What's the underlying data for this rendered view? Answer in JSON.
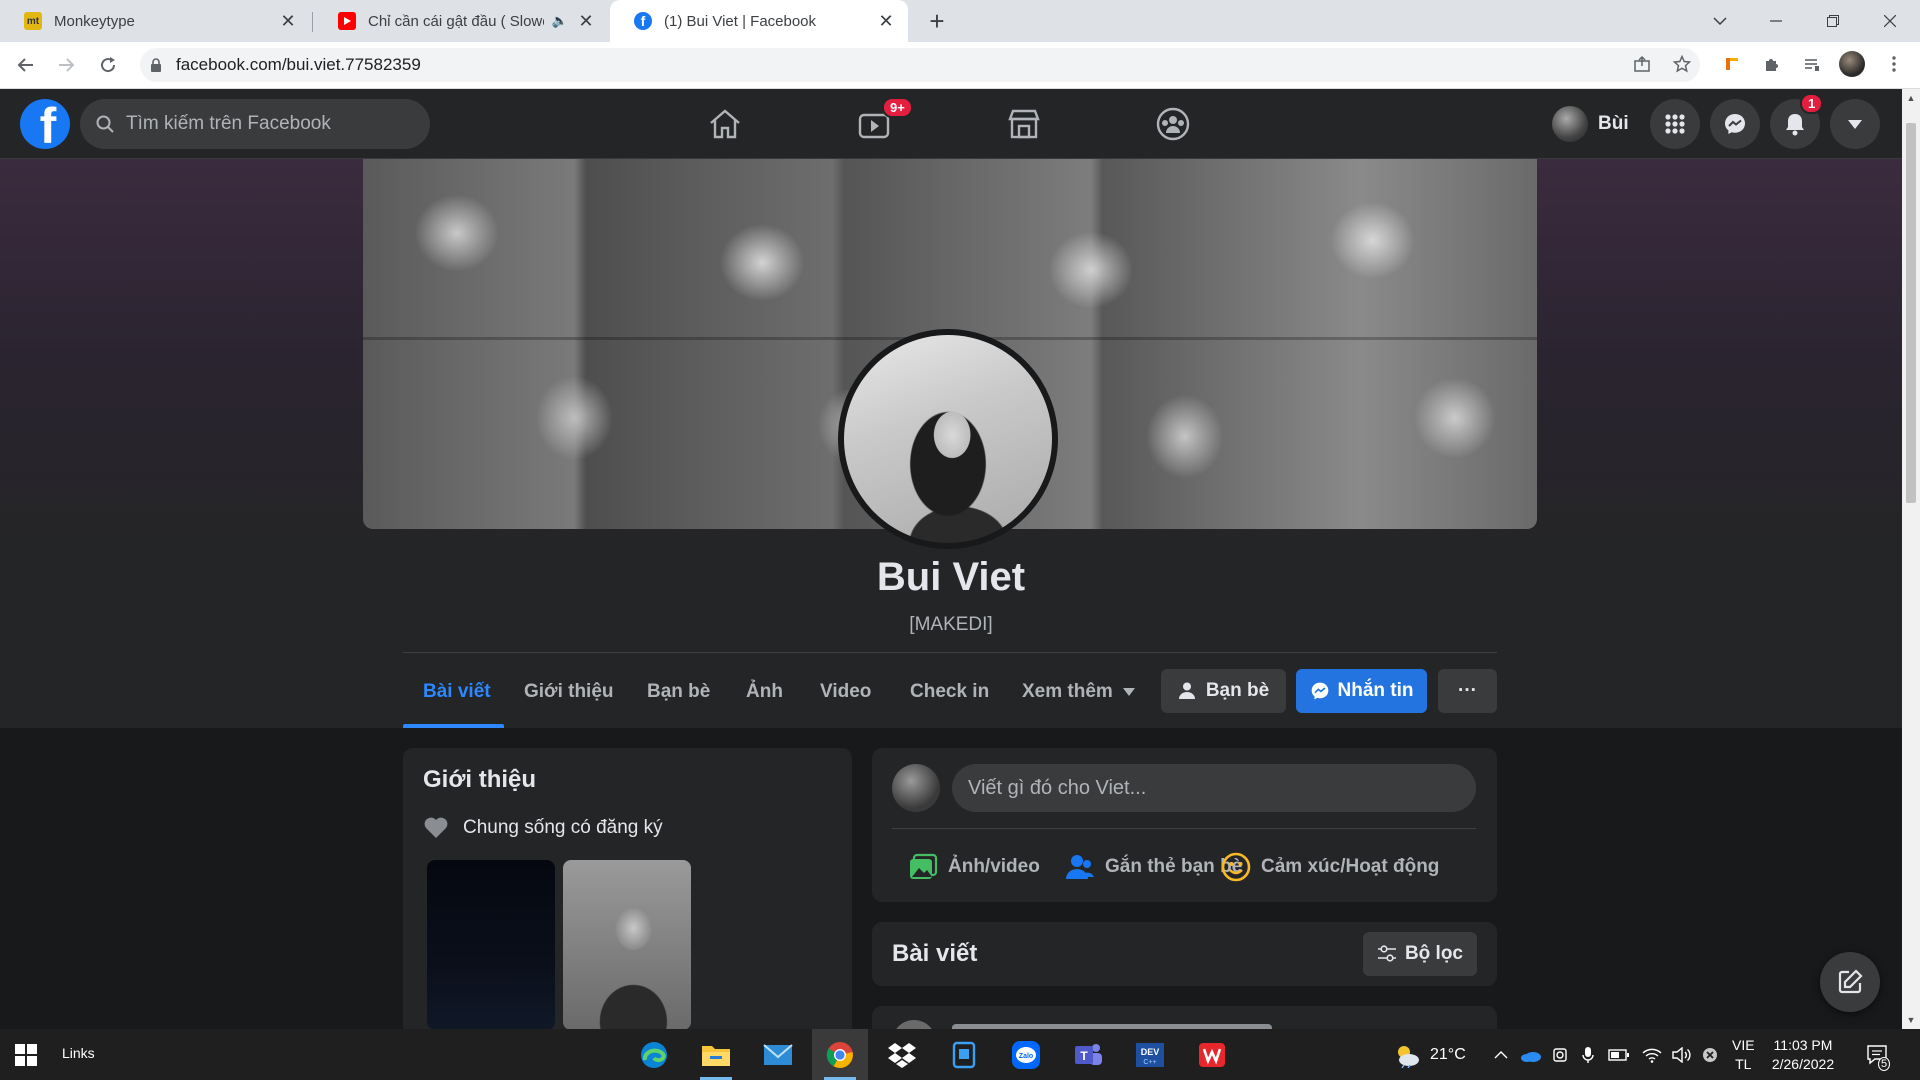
{
  "browser": {
    "tabs": [
      {
        "title": "Monkeytype",
        "favicon": "monkeytype-icon"
      },
      {
        "title": "Chỉ cần cái gật đầu ( Slowed",
        "favicon": "youtube-icon",
        "audio": true
      },
      {
        "title": "(1) Bui Viet | Facebook",
        "favicon": "facebook-icon",
        "active": true
      }
    ],
    "url": "facebook.com/bui.viet.77582359"
  },
  "fb": {
    "search_placeholder": "Tìm kiếm trên Facebook",
    "watch_badge": "9+",
    "notif_badge": "1",
    "user_short": "Bùi"
  },
  "profile": {
    "name": "Bui Viet",
    "subtitle": "[MAKEDI]",
    "tabs": [
      "Bài viết",
      "Giới thiệu",
      "Bạn bè",
      "Ảnh",
      "Video",
      "Check in",
      "Xem thêm"
    ],
    "btn_friends": "Bạn bè",
    "btn_message": "Nhắn tin",
    "btn_more": "···"
  },
  "intro": {
    "title": "Giới thiệu",
    "relationship": "Chung sống có đăng ký"
  },
  "composer": {
    "placeholder": "Viết gì đó cho Viet...",
    "actions": [
      "Ảnh/video",
      "Gắn thẻ bạn bè",
      "Cảm xúc/Hoạt động"
    ]
  },
  "posts": {
    "title": "Bài viết",
    "filter": "Bộ lọc"
  },
  "taskbar": {
    "links": "Links",
    "weather": "21°C",
    "lang_top": "VIE",
    "lang_bottom": "TL",
    "time": "11:03 PM",
    "date": "2/26/2022",
    "notif_count": "5"
  },
  "colors": {
    "fb_blue": "#1877f2",
    "accent": "#2d88ff",
    "badge_red": "#e41e3f",
    "surface": "#242526",
    "background": "#18191a"
  }
}
